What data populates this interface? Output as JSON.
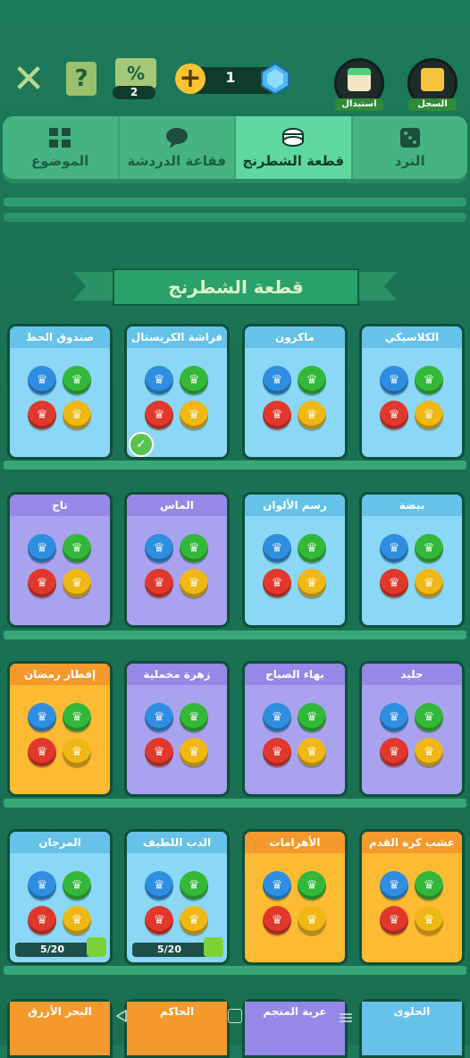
{
  "top": {
    "coupon_count": "2",
    "gem_count": "1",
    "swap_label": "استبدال",
    "history_label": "السجل",
    "help_glyph": "?",
    "coupon_glyph": "%"
  },
  "tabs": [
    {
      "label": "الموضوع",
      "icon": "grid-icon"
    },
    {
      "label": "فقاعة الدردشة",
      "icon": "chat-icon"
    },
    {
      "label": "قطعة الشطرنج",
      "icon": "piece-icon",
      "active": true
    },
    {
      "label": "النرد",
      "icon": "dice-icon"
    }
  ],
  "section_title": "قطعة الشطرنج",
  "rows": [
    [
      {
        "title": "صندوق الحظ",
        "theme": "blue",
        "pieces": [
          "chest",
          "chest",
          "chest",
          "chest"
        ]
      },
      {
        "title": "فراشة الكريستال",
        "theme": "blue",
        "pieces": [
          "butterfly",
          "butterfly",
          "butterfly",
          "butterfly"
        ],
        "selected": true
      },
      {
        "title": "ماكرون",
        "theme": "blue",
        "pieces": [
          "macaron",
          "macaron",
          "macaron",
          "macaron"
        ]
      },
      {
        "title": "الكلاسيكي",
        "theme": "blue",
        "pieces": [
          "classic",
          "classic",
          "classic",
          "classic"
        ]
      }
    ],
    [
      {
        "title": "تاج",
        "theme": "purple",
        "pieces": [
          "crown",
          "crown",
          "crown",
          "crown"
        ]
      },
      {
        "title": "الماس",
        "theme": "purple",
        "pieces": [
          "diamond",
          "diamond",
          "diamond",
          "diamond"
        ]
      },
      {
        "title": "رسم الألوان",
        "theme": "blue",
        "pieces": [
          "paint",
          "paint",
          "paint",
          "paint"
        ]
      },
      {
        "title": "بيضة",
        "theme": "blue",
        "pieces": [
          "egg",
          "egg",
          "egg",
          "egg"
        ]
      }
    ],
    [
      {
        "title": "إفطار رمضان",
        "theme": "orange",
        "pieces": [
          "lantern",
          "lantern",
          "lantern",
          "lantern"
        ]
      },
      {
        "title": "زهرة مخملية",
        "theme": "purple",
        "pieces": [
          "rose",
          "rose",
          "rose",
          "rose"
        ]
      },
      {
        "title": "بهاء الصباح",
        "theme": "purple",
        "pieces": [
          "gloria",
          "gloria",
          "gloria",
          "gloria"
        ]
      },
      {
        "title": "جليد",
        "theme": "purple",
        "pieces": [
          "snowman",
          "snowman",
          "snowman",
          "snowman"
        ]
      }
    ],
    [
      {
        "title": "المرجان",
        "theme": "blue",
        "pieces": [
          "coral",
          "coral",
          "coral",
          "coral"
        ],
        "progress": "5/20"
      },
      {
        "title": "الدب اللطيف",
        "theme": "blue",
        "pieces": [
          "bear",
          "bear",
          "bear",
          "bear"
        ],
        "progress": "5/20"
      },
      {
        "title": "الأهرامات",
        "theme": "orange",
        "pieces": [
          "pyramid",
          "pyramid",
          "pyramid",
          "pyramid"
        ]
      },
      {
        "title": "عشب كرة القدم",
        "theme": "orange",
        "pieces": [
          "ball",
          "ball",
          "ball",
          "ball"
        ]
      }
    ]
  ],
  "peek_row": [
    {
      "title": "البحر الأزرق",
      "theme": "orange"
    },
    {
      "title": "الحاكم",
      "theme": "orange"
    },
    {
      "title": "عربة المنجم",
      "theme": "purple"
    },
    {
      "title": "الحلوى",
      "theme": "blue"
    }
  ],
  "piece_colors": [
    "#2f8ee0",
    "#33b83a",
    "#e0392c",
    "#f0b817"
  ]
}
